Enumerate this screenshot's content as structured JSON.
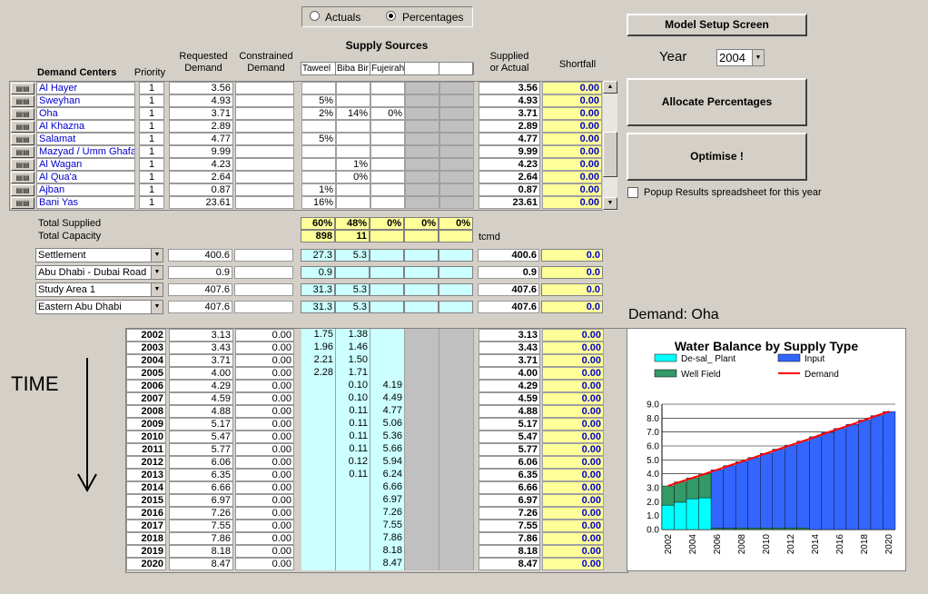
{
  "radio": {
    "actuals": "Actuals",
    "percentages": "Percentages",
    "selected": "percentages"
  },
  "buttons": {
    "model_setup": "Model Setup Screen",
    "allocate": "Allocate Percentages",
    "optimise": "Optimise !"
  },
  "year": {
    "label": "Year",
    "value": "2004"
  },
  "popup_label": "Popup Results spreadsheet for this year",
  "headers": {
    "demand_centers": "Demand Centers",
    "priority": "Priority",
    "requested": "Requested\nDemand",
    "constrained": "Constrained\nDemand",
    "supply_sources": "Supply Sources",
    "supplied": "Supplied\nor Actual",
    "shortfall": "Shortfall",
    "sources": [
      "Taweel",
      "Biba Bir",
      "Fujeirah",
      "",
      ""
    ]
  },
  "centers": [
    {
      "name": "Al Hayer",
      "priority": "1",
      "requested": "3.56",
      "src": [
        "",
        "",
        "",
        "",
        ""
      ],
      "supplied": "3.56",
      "shortfall": "0.00"
    },
    {
      "name": "Sweyhan",
      "priority": "1",
      "requested": "4.93",
      "src": [
        "5%",
        "",
        "",
        "",
        ""
      ],
      "supplied": "4.93",
      "shortfall": "0.00"
    },
    {
      "name": "Oha",
      "priority": "1",
      "requested": "3.71",
      "src": [
        "2%",
        "14%",
        "0%",
        "",
        ""
      ],
      "supplied": "3.71",
      "shortfall": "0.00"
    },
    {
      "name": "Al Khazna",
      "priority": "1",
      "requested": "2.89",
      "src": [
        "",
        "",
        "",
        "",
        ""
      ],
      "supplied": "2.89",
      "shortfall": "0.00"
    },
    {
      "name": "Salamat",
      "priority": "1",
      "requested": "4.77",
      "src": [
        "5%",
        "",
        "",
        "",
        ""
      ],
      "supplied": "4.77",
      "shortfall": "0.00"
    },
    {
      "name": "Mazyad / Umm Ghafa",
      "priority": "1",
      "requested": "9.99",
      "src": [
        "",
        "",
        "",
        "",
        ""
      ],
      "supplied": "9.99",
      "shortfall": "0.00"
    },
    {
      "name": "Al Wagan",
      "priority": "1",
      "requested": "4.23",
      "src": [
        "",
        "1%",
        "",
        "",
        ""
      ],
      "supplied": "4.23",
      "shortfall": "0.00"
    },
    {
      "name": "Al Qua'a",
      "priority": "1",
      "requested": "2.64",
      "src": [
        "",
        "0%",
        "",
        "",
        ""
      ],
      "supplied": "2.64",
      "shortfall": "0.00"
    },
    {
      "name": "Ajban",
      "priority": "1",
      "requested": "0.87",
      "src": [
        "1%",
        "",
        "",
        "",
        ""
      ],
      "supplied": "0.87",
      "shortfall": "0.00"
    },
    {
      "name": "Bani Yas",
      "priority": "1",
      "requested": "23.61",
      "src": [
        "16%",
        "",
        "",
        "",
        ""
      ],
      "supplied": "23.61",
      "shortfall": "0.00"
    }
  ],
  "totals": {
    "supplied_label": "Total Supplied",
    "capacity_label": "Total Capacity",
    "supplied": [
      "60%",
      "48%",
      "0%",
      "0%",
      "0%"
    ],
    "capacity": [
      "898",
      "11",
      "",
      "",
      ""
    ],
    "unit": "tcmd"
  },
  "groups": [
    {
      "name": "Settlement",
      "requested": "400.6",
      "src": [
        "27.3",
        "5.3",
        "",
        "",
        ""
      ],
      "supplied": "400.6",
      "shortfall": "0.0"
    },
    {
      "name": "Abu Dhabi - Dubai Road",
      "requested": "0.9",
      "src": [
        "0.9",
        "",
        "",
        "",
        ""
      ],
      "supplied": "0.9",
      "shortfall": "0.0"
    },
    {
      "name": "Study Area 1",
      "requested": "407.6",
      "src": [
        "31.3",
        "5.3",
        "",
        "",
        ""
      ],
      "supplied": "407.6",
      "shortfall": "0.0"
    },
    {
      "name": "Eastern Abu Dhabi",
      "requested": "407.6",
      "src": [
        "31.3",
        "5.3",
        "",
        "",
        ""
      ],
      "supplied": "407.6",
      "shortfall": "0.0"
    }
  ],
  "time_label": "TIME",
  "years": [
    {
      "year": "2002",
      "requested": "3.13",
      "constrained": "0.00",
      "src": [
        "1.75",
        "1.38",
        "",
        "",
        ""
      ],
      "supplied": "3.13",
      "shortfall": "0.00"
    },
    {
      "year": "2003",
      "requested": "3.43",
      "constrained": "0.00",
      "src": [
        "1.96",
        "1.46",
        "",
        "",
        ""
      ],
      "supplied": "3.43",
      "shortfall": "0.00"
    },
    {
      "year": "2004",
      "requested": "3.71",
      "constrained": "0.00",
      "src": [
        "2.21",
        "1.50",
        "",
        "",
        ""
      ],
      "supplied": "3.71",
      "shortfall": "0.00"
    },
    {
      "year": "2005",
      "requested": "4.00",
      "constrained": "0.00",
      "src": [
        "2.28",
        "1.71",
        "",
        "",
        ""
      ],
      "supplied": "4.00",
      "shortfall": "0.00"
    },
    {
      "year": "2006",
      "requested": "4.29",
      "constrained": "0.00",
      "src": [
        "",
        "0.10",
        "4.19",
        "",
        ""
      ],
      "supplied": "4.29",
      "shortfall": "0.00"
    },
    {
      "year": "2007",
      "requested": "4.59",
      "constrained": "0.00",
      "src": [
        "",
        "0.10",
        "4.49",
        "",
        ""
      ],
      "supplied": "4.59",
      "shortfall": "0.00"
    },
    {
      "year": "2008",
      "requested": "4.88",
      "constrained": "0.00",
      "src": [
        "",
        "0.11",
        "4.77",
        "",
        ""
      ],
      "supplied": "4.88",
      "shortfall": "0.00"
    },
    {
      "year": "2009",
      "requested": "5.17",
      "constrained": "0.00",
      "src": [
        "",
        "0.11",
        "5.06",
        "",
        ""
      ],
      "supplied": "5.17",
      "shortfall": "0.00"
    },
    {
      "year": "2010",
      "requested": "5.47",
      "constrained": "0.00",
      "src": [
        "",
        "0.11",
        "5.36",
        "",
        ""
      ],
      "supplied": "5.47",
      "shortfall": "0.00"
    },
    {
      "year": "2011",
      "requested": "5.77",
      "constrained": "0.00",
      "src": [
        "",
        "0.11",
        "5.66",
        "",
        ""
      ],
      "supplied": "5.77",
      "shortfall": "0.00"
    },
    {
      "year": "2012",
      "requested": "6.06",
      "constrained": "0.00",
      "src": [
        "",
        "0.12",
        "5.94",
        "",
        ""
      ],
      "supplied": "6.06",
      "shortfall": "0.00"
    },
    {
      "year": "2013",
      "requested": "6.35",
      "constrained": "0.00",
      "src": [
        "",
        "0.11",
        "6.24",
        "",
        ""
      ],
      "supplied": "6.35",
      "shortfall": "0.00"
    },
    {
      "year": "2014",
      "requested": "6.66",
      "constrained": "0.00",
      "src": [
        "",
        "",
        "6.66",
        "",
        ""
      ],
      "supplied": "6.66",
      "shortfall": "0.00"
    },
    {
      "year": "2015",
      "requested": "6.97",
      "constrained": "0.00",
      "src": [
        "",
        "",
        "6.97",
        "",
        ""
      ],
      "supplied": "6.97",
      "shortfall": "0.00"
    },
    {
      "year": "2016",
      "requested": "7.26",
      "constrained": "0.00",
      "src": [
        "",
        "",
        "7.26",
        "",
        ""
      ],
      "supplied": "7.26",
      "shortfall": "0.00"
    },
    {
      "year": "2017",
      "requested": "7.55",
      "constrained": "0.00",
      "src": [
        "",
        "",
        "7.55",
        "",
        ""
      ],
      "supplied": "7.55",
      "shortfall": "0.00"
    },
    {
      "year": "2018",
      "requested": "7.86",
      "constrained": "0.00",
      "src": [
        "",
        "",
        "7.86",
        "",
        ""
      ],
      "supplied": "7.86",
      "shortfall": "0.00"
    },
    {
      "year": "2019",
      "requested": "8.18",
      "constrained": "0.00",
      "src": [
        "",
        "",
        "8.18",
        "",
        ""
      ],
      "supplied": "8.18",
      "shortfall": "0.00"
    },
    {
      "year": "2020",
      "requested": "8.47",
      "constrained": "0.00",
      "src": [
        "",
        "",
        "8.47",
        "",
        ""
      ],
      "supplied": "8.47",
      "shortfall": "0.00"
    }
  ],
  "demand_label": "Demand: Oha",
  "chart_data": {
    "type": "bar",
    "title": "Water Balance by Supply Type",
    "categories": [
      "2002",
      "2003",
      "2004",
      "2005",
      "2006",
      "2007",
      "2008",
      "2009",
      "2010",
      "2011",
      "2012",
      "2013",
      "2014",
      "2015",
      "2016",
      "2017",
      "2018",
      "2019",
      "2020"
    ],
    "x_tick_labels": [
      "2002",
      "2004",
      "2006",
      "2008",
      "2010",
      "2012",
      "2014",
      "2016",
      "2018",
      "2020"
    ],
    "series": [
      {
        "name": "De-sal_ Plant",
        "color": "#00ffff",
        "values": [
          1.75,
          1.96,
          2.21,
          2.28,
          0,
          0,
          0,
          0,
          0,
          0,
          0,
          0,
          0,
          0,
          0,
          0,
          0,
          0,
          0
        ]
      },
      {
        "name": "Well Field",
        "color": "#339966",
        "values": [
          1.38,
          1.46,
          1.5,
          1.71,
          0.1,
          0.1,
          0.11,
          0.11,
          0.11,
          0.11,
          0.12,
          0.11,
          0,
          0,
          0,
          0,
          0,
          0,
          0
        ]
      },
      {
        "name": "Input",
        "color": "#3366ff",
        "values": [
          0,
          0,
          0,
          0,
          4.19,
          4.49,
          4.77,
          5.06,
          5.36,
          5.66,
          5.94,
          6.24,
          6.66,
          6.97,
          7.26,
          7.55,
          7.86,
          8.18,
          8.47
        ]
      }
    ],
    "line": {
      "name": "Demand",
      "color": "#ff0000",
      "values": [
        3.13,
        3.43,
        3.71,
        4.0,
        4.29,
        4.59,
        4.88,
        5.17,
        5.47,
        5.77,
        6.06,
        6.35,
        6.66,
        6.97,
        7.26,
        7.55,
        7.86,
        8.18,
        8.47
      ]
    },
    "stacked": true,
    "ylim": [
      0,
      9
    ],
    "yticks": [
      "0.0",
      "1.0",
      "2.0",
      "3.0",
      "4.0",
      "5.0",
      "6.0",
      "7.0",
      "8.0",
      "9.0"
    ],
    "legend": "top",
    "grid": true
  }
}
